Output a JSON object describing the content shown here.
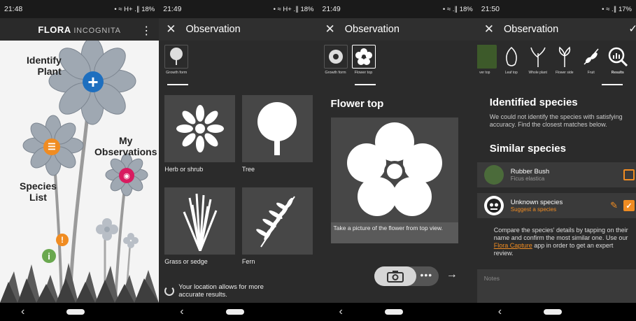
{
  "screens": {
    "home": {
      "status": {
        "time": "21:48",
        "right": "• ≈ H+ .∥ 18%"
      },
      "appbar": {
        "logo": "FLORA",
        "logo_sub": "INCOGNITA"
      },
      "labels": {
        "identify": "Identify\nPlant",
        "observations": "My\nObservations",
        "species_list": "Species\nList"
      }
    },
    "growth": {
      "status": {
        "time": "21:49",
        "right": "• ≈ H+ .∥ 18%"
      },
      "title": "Observation",
      "tab_label": "Growth form",
      "options": [
        "Herb or shrub",
        "Tree",
        "Grass or sedge",
        "Fern"
      ],
      "location_text": "Your location allows for more accurate results."
    },
    "flower": {
      "status": {
        "time": "21:49",
        "right": "• ≈ .∥ 18%"
      },
      "title": "Observation",
      "tabs": [
        "Growth form",
        "Flower top"
      ],
      "section_title": "Flower top",
      "caption": "Take a picture of the flower from top view."
    },
    "results": {
      "status": {
        "time": "21:50",
        "right": "• ≈ .∥ 17%"
      },
      "title": "Observation",
      "tabs": [
        "ver top",
        "Leaf top",
        "Whole plant",
        "Flower side",
        "Fruit",
        "Results"
      ],
      "identified_title": "Identified species",
      "identified_text": "We could not identify the species with satisfying accuracy. Find the closest matches below.",
      "similar_title": "Similar species",
      "species": [
        {
          "name": "Rubber Bush",
          "sub": "Ficus elastica"
        },
        {
          "name": "Unknown species",
          "sub": "Suggest a species"
        }
      ],
      "compare_text_pre": "Compare the species' details by tapping on their name and confirm the most similar one. Use our ",
      "compare_link": "Flora Capture",
      "compare_text_post": " app in order to get an expert review.",
      "notes_placeholder": "Notes"
    }
  },
  "colors": {
    "accent": "#f08c22",
    "blue": "#1e6fbf",
    "magenta": "#d81b60",
    "green": "#6aa84f"
  }
}
